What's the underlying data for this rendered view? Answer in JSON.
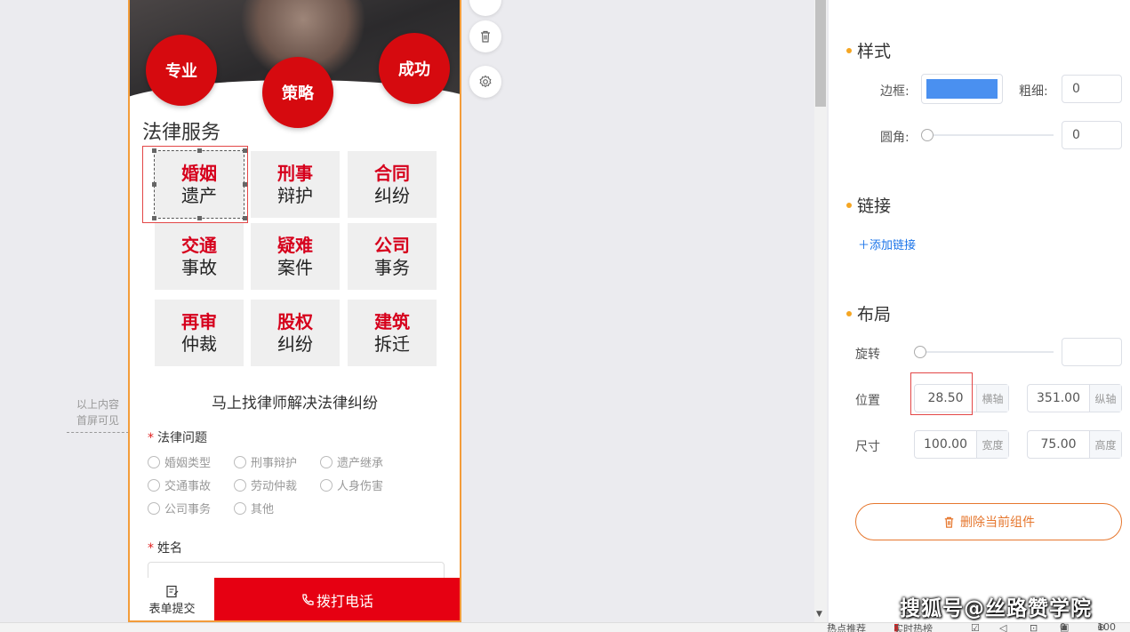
{
  "canvas": {
    "fold_note_line1": "以上内容",
    "fold_note_line2": "首屏可见"
  },
  "banner": {
    "circles": [
      "专业",
      "策略",
      "成功"
    ]
  },
  "section_title": "法律服务",
  "services": [
    {
      "t1": "婚姻",
      "t2": "遗产"
    },
    {
      "t1": "刑事",
      "t2": "辩护"
    },
    {
      "t1": "合同",
      "t2": "纠纷"
    },
    {
      "t1": "交通",
      "t2": "事故"
    },
    {
      "t1": "疑难",
      "t2": "案件"
    },
    {
      "t1": "公司",
      "t2": "事务"
    },
    {
      "t1": "再审",
      "t2": "仲裁"
    },
    {
      "t1": "股权",
      "t2": "纠纷"
    },
    {
      "t1": "建筑",
      "t2": "拆迁"
    }
  ],
  "form": {
    "title": "马上找律师解决法律纠纷",
    "required_mark": "*",
    "question_label": "法律问题",
    "options": [
      "婚姻类型",
      "刑事辩护",
      "遗产继承",
      "交通事故",
      "劳动仲裁",
      "人身伤害",
      "公司事务",
      "其他"
    ],
    "name_label": "姓名",
    "name_value": ""
  },
  "bottom_bar": {
    "submit_label": "表单提交",
    "call_label": "拨打电话"
  },
  "panel": {
    "style_title": "样式",
    "border_label": "边框:",
    "border_color": "#4a90f0",
    "thickness_label": "粗细:",
    "thickness_value": "0",
    "radius_label": "圆角:",
    "radius_value": "0",
    "link_title": "链接",
    "add_link_label": "添加链接",
    "layout_title": "布局",
    "rotate_label": "旋转",
    "rotate_value": "",
    "position_label": "位置",
    "pos_x": "28.50",
    "pos_x_suffix": "横轴",
    "pos_y": "351.00",
    "pos_y_suffix": "纵轴",
    "size_label": "尺寸",
    "width": "100.00",
    "width_suffix": "宽度",
    "height": "75.00",
    "height_suffix": "高度",
    "delete_label": "删除当前组件"
  },
  "colors": {
    "accent_red": "#e60012",
    "brand_orange": "#e6772e",
    "link_blue": "#1a73e8"
  },
  "status_bar": {
    "hot_recommend": "热点推荐",
    "realtime_hot": "实时热榜",
    "badge_count": "0",
    "zoom": "100"
  },
  "watermark": "搜狐号@丝路赞学院"
}
